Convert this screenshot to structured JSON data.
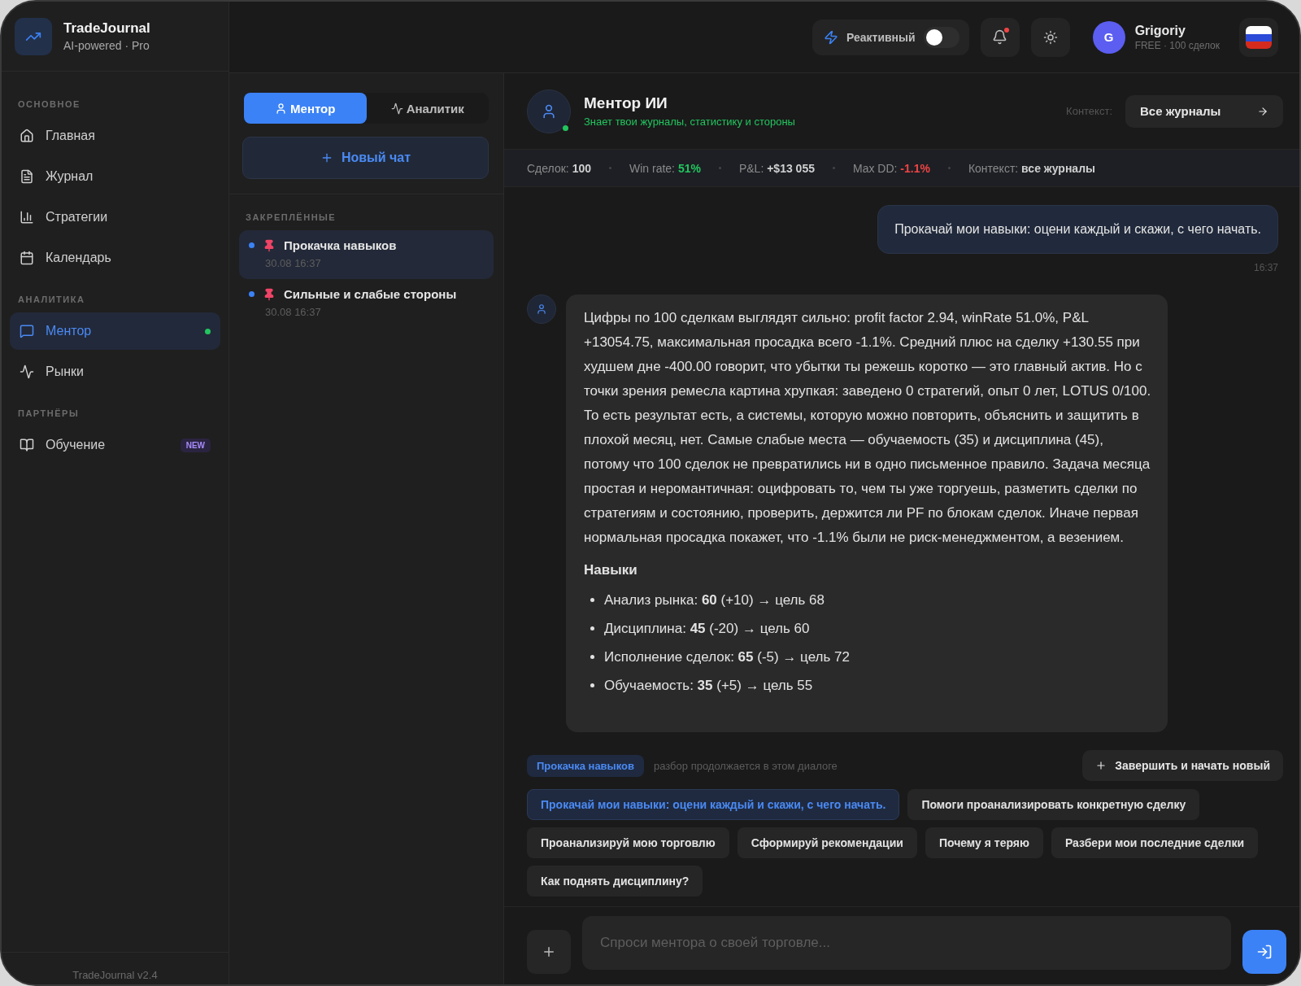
{
  "brand": {
    "name": "TradeJournal",
    "tagline": "AI-powered · Pro"
  },
  "sidebar": {
    "sections": [
      {
        "title": "ОСНОВНОЕ",
        "items": [
          {
            "label": "Главная",
            "selected": false
          },
          {
            "label": "Журнал",
            "selected": false
          },
          {
            "label": "Стратегии",
            "selected": false
          },
          {
            "label": "Календарь",
            "selected": false
          }
        ]
      },
      {
        "title": "АНАЛИТИКА",
        "items": [
          {
            "label": "Ментор",
            "selected": true,
            "online": true
          },
          {
            "label": "Рынки",
            "selected": false
          }
        ]
      },
      {
        "title": "ПАРТНЁРЫ",
        "items": [
          {
            "label": "Обучение",
            "selected": false,
            "badge": "NEW"
          }
        ]
      }
    ],
    "footer": "TradeJournal v2.4"
  },
  "topbar": {
    "reactive": {
      "label": "Реактивный",
      "on": false
    },
    "notifications": {
      "unread": true
    },
    "user": {
      "initial": "G",
      "name": "Grigoriy",
      "plan": "FREE · 100 сделок"
    }
  },
  "chat_list": {
    "tabs": [
      {
        "label": "Ментор",
        "selected": true
      },
      {
        "label": "Аналитик",
        "selected": false
      }
    ],
    "new_chat": "Новый чат",
    "section": "ЗАКРЕПЛЁННЫЕ",
    "items": [
      {
        "title": "Прокачка навыков",
        "time": "30.08 16:37",
        "selected": true
      },
      {
        "title": "Сильные и слабые стороны",
        "time": "30.08 16:37",
        "selected": false
      }
    ]
  },
  "chat": {
    "title": "Ментор ИИ",
    "subtitle": "Знает твои журналы, статистику и стороны",
    "online": true,
    "context_label": "Контекст:",
    "context_value": "Все журналы",
    "stats": [
      {
        "label": "Сделок:",
        "value": "100",
        "color": "#d0d0d0"
      },
      {
        "label": "Win rate:",
        "value": "51%",
        "color": "#22c55e"
      },
      {
        "label": "P&L:",
        "value": "+$13 055",
        "color": "#d0d0d0"
      },
      {
        "label": "Max DD:",
        "value": "-1.1%",
        "color": "#ef4444"
      },
      {
        "label": "Контекст:",
        "value": "все журналы",
        "color": "#d0d0d0"
      }
    ],
    "messages": [
      {
        "kind": "user",
        "text": "Прокачай мои навыки: оцени каждый и скажи, с чего начать.",
        "time": "16:37"
      },
      {
        "kind": "assistant",
        "text": "Цифры по 100 сделкам выглядят сильно: profit factor 2.94, winRate 51.0%, P&L +13054.75, максимальная просадка всего -1.1%. Средний плюс на сделку +130.55 при худшем дне -400.00 говорит, что убытки ты режешь коротко — это главный актив. Но с точки зрения ремесла картина хрупкая: заведено 0 стратегий, опыт 0 лет, LOTUS 0/100. То есть результат есть, а системы, которую можно повторить, объяснить и защитить в плохой месяц, нет. Самые слабые места — обучаемость (35) и дисциплина (45), потому что 100 сделок не превратились ни в одно письменное правило. Задача месяца простая и неромантичная: оцифровать то, чем ты уже торгуешь, разметить сделки по стратегиям и состоянию, проверить, держится ли PF по блокам сделок. Иначе первая нормальная просадка покажет, что -1.1% были не риск-менеджментом, а везением.",
        "heading": "Навыки",
        "bullets": [
          "Анализ рынка: **60** (+10) → цель 68",
          "Дисциплина: **45** (-20) → цель 60",
          "Исполнение сделок: **65** (-5) → цель 72",
          "Обучаемость: **35** (+5) → цель 55"
        ]
      }
    ],
    "topic": {
      "tag": "Прокачка навыков",
      "note": "разбор продолжается в этом диалоге",
      "action": "Завершить и начать новый"
    },
    "suggestions": [
      {
        "label": "Прокачай мои навыки: оцени каждый и скажи, с чего начать.",
        "selected": true
      },
      {
        "label": "Помоги проанализировать конкретную сделку",
        "selected": false
      },
      {
        "label": "Проанализируй мою торговлю",
        "selected": false
      },
      {
        "label": "Сформируй рекомендации",
        "selected": false
      },
      {
        "label": "Почему я теряю",
        "selected": false
      },
      {
        "label": "Разбери мои последние сделки",
        "selected": false
      },
      {
        "label": "Как поднять дисциплину?",
        "selected": false
      }
    ],
    "input": {
      "placeholder": "Спроси ментора о своей торговле..."
    }
  }
}
